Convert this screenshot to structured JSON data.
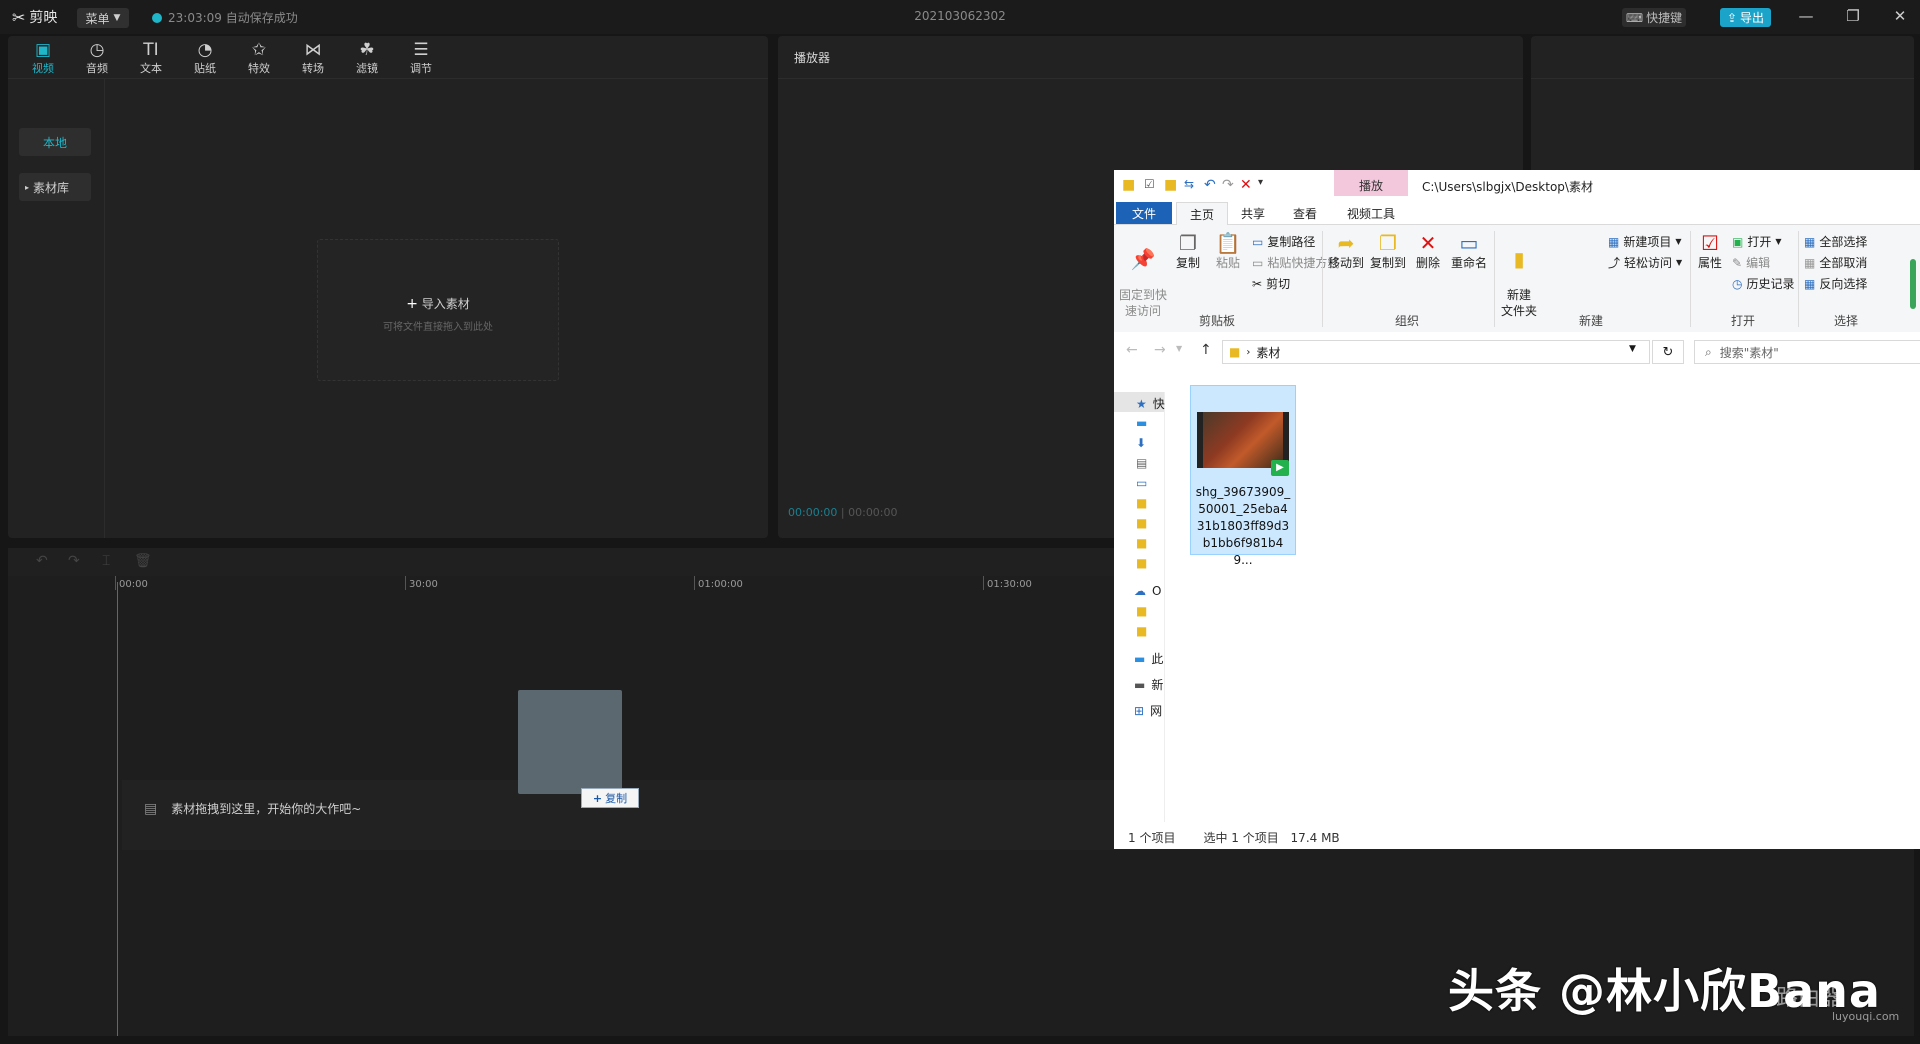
{
  "app": {
    "name": "剪映",
    "menu_label": "菜单",
    "autosave_text": "23:03:09 自动保存成功",
    "project_title": "202103062302",
    "shortcut_label": "快捷键",
    "export_label": "导出"
  },
  "toolbar": {
    "items": [
      {
        "label": "视频",
        "icon": "video-icon",
        "glyph": "▣"
      },
      {
        "label": "音频",
        "icon": "audio-icon",
        "glyph": "◷"
      },
      {
        "label": "文本",
        "icon": "text-icon",
        "glyph": "TI"
      },
      {
        "label": "贴纸",
        "icon": "sticker-icon",
        "glyph": "◔"
      },
      {
        "label": "特效",
        "icon": "effects-icon",
        "glyph": "✩"
      },
      {
        "label": "转场",
        "icon": "transition-icon",
        "glyph": "⋈"
      },
      {
        "label": "滤镜",
        "icon": "filter-icon",
        "glyph": "☘"
      },
      {
        "label": "调节",
        "icon": "adjust-icon",
        "glyph": "☰"
      }
    ],
    "active_color": "#1fb6c9"
  },
  "media": {
    "side_local": "本地",
    "side_library": "素材库",
    "import_label": "导入素材",
    "import_hint": "可将文件直接拖入到此处"
  },
  "player": {
    "title": "播放器",
    "current_time": "00:00:00",
    "total_time": "00:00:00"
  },
  "timeline": {
    "ticks": [
      "00:00",
      "30:00",
      "01:00:00",
      "01:30:00"
    ],
    "drop_hint": "素材拖拽到这里，开始你的大作吧~",
    "copy_badge": "复制"
  },
  "explorer": {
    "context_tab": "播放",
    "path": "C:\\Users\\slbgjx\\Desktop\\素材",
    "tabs": {
      "file": "文件",
      "home": "主页",
      "share": "共享",
      "view": "查看",
      "video_tools": "视频工具"
    },
    "ribbon": {
      "pin": "固定到快\n速访问",
      "copy": "复制",
      "paste": "粘贴",
      "copy_path": "复制路径",
      "paste_shortcut": "粘贴快捷方式",
      "cut": "剪切",
      "move_to": "移动到",
      "copy_to": "复制到",
      "delete": "删除",
      "rename": "重命名",
      "new_folder": "新建\n文件夹",
      "new_item": "新建项目",
      "easy_access": "轻松访问",
      "properties": "属性",
      "open": "打开",
      "edit": "编辑",
      "history": "历史记录",
      "select_all": "全部选择",
      "select_none": "全部取消",
      "invert": "反向选择",
      "group_clipboard": "剪贴板",
      "group_organize": "组织",
      "group_new": "新建",
      "group_open": "打开",
      "group_select": "选择"
    },
    "address": "素材",
    "search_placeholder": "搜索\"素材\"",
    "nav": [
      "快",
      "",
      "",
      "",
      "",
      "",
      "",
      "",
      "",
      "O",
      "",
      "",
      "此",
      "新",
      "网"
    ],
    "file_name": "shg_39673909_50001_25eba431b1803ff89d3b1bb6f981b49...",
    "status_count": "1 个项目",
    "status_selected": "选中 1 个项目",
    "status_size": "17.4 MB"
  },
  "watermark": {
    "text": "头条 @林小欣Bana",
    "site": "路由器",
    "url": "luyouqi.com"
  }
}
